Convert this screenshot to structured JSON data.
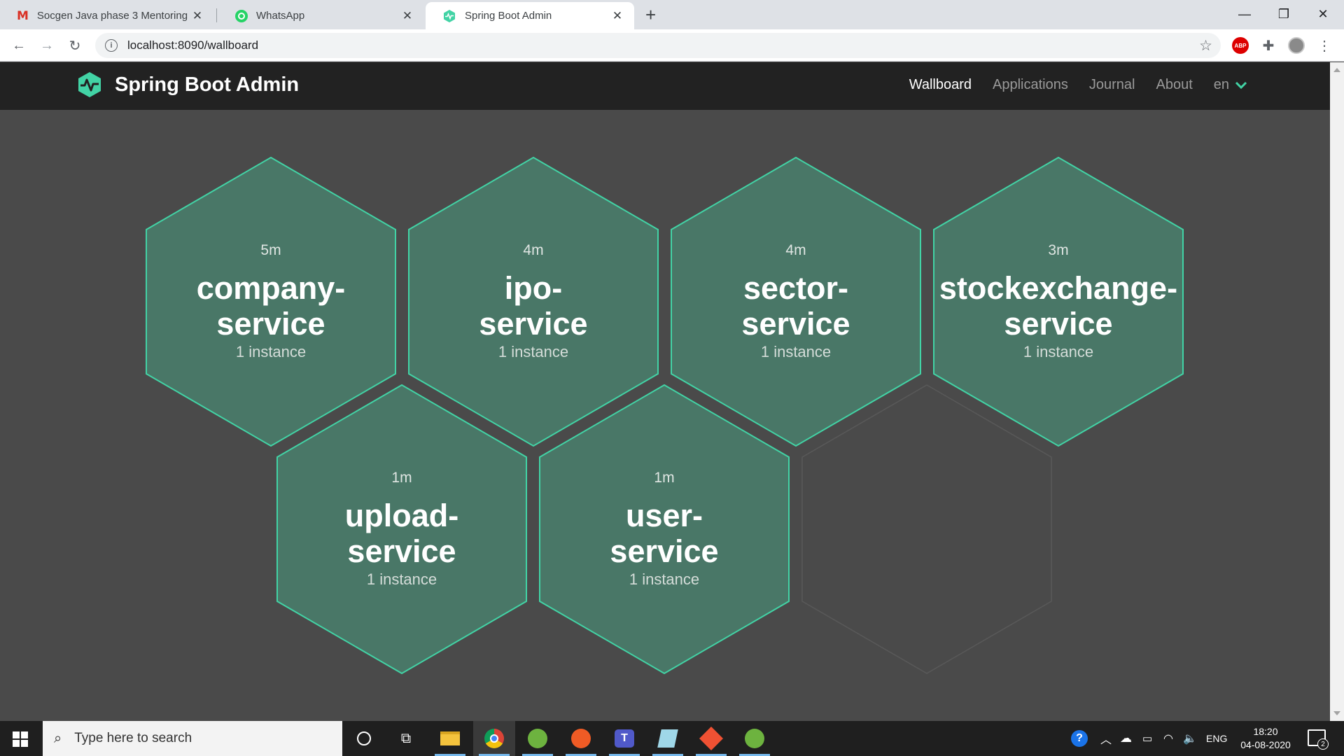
{
  "browser": {
    "tabs": [
      {
        "title": "Socgen Java phase 3 Mentoring",
        "icon": "gmail-icon",
        "active": false
      },
      {
        "title": "WhatsApp",
        "icon": "whatsapp-icon",
        "active": false
      },
      {
        "title": "Spring Boot Admin",
        "icon": "spring-boot-admin-icon",
        "active": true
      }
    ],
    "url": "localhost:8090/wallboard",
    "extensions": {
      "abp_label": "ABP"
    }
  },
  "app": {
    "brand": "Spring Boot Admin",
    "accent_color": "#42d3a5",
    "nav": {
      "wallboard": "Wallboard",
      "applications": "Applications",
      "journal": "Journal",
      "about": "About",
      "language": "en"
    }
  },
  "wallboard": {
    "applications": [
      {
        "time": "5m",
        "name_line1": "company-",
        "name_line2": "service",
        "instances": "1 instance",
        "status": "UP"
      },
      {
        "time": "4m",
        "name_line1": "ipo-",
        "name_line2": "service",
        "instances": "1 instance",
        "status": "UP"
      },
      {
        "time": "4m",
        "name_line1": "sector-",
        "name_line2": "service",
        "instances": "1 instance",
        "status": "UP"
      },
      {
        "time": "3m",
        "name_line1": "stockexchange-",
        "name_line2": "service",
        "instances": "1 instance",
        "status": "UP"
      },
      {
        "time": "1m",
        "name_line1": "upload-",
        "name_line2": "service",
        "instances": "1 instance",
        "status": "UP"
      },
      {
        "time": "1m",
        "name_line1": "user-",
        "name_line2": "service",
        "instances": "1 instance",
        "status": "UP"
      }
    ],
    "colors": {
      "up_fill": "#497767",
      "up_stroke": "#42d3a5",
      "empty_stroke": "#595959"
    }
  },
  "taskbar": {
    "search_placeholder": "Type here to search",
    "tray": {
      "language": "ENG",
      "time": "18:20",
      "date": "04-08-2020",
      "notification_count": "2"
    }
  }
}
